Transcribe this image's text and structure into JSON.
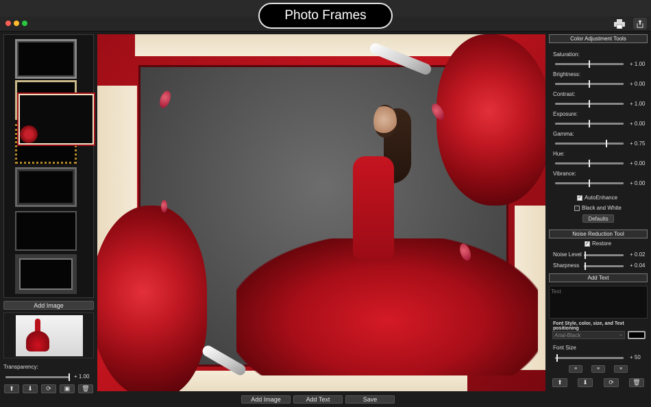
{
  "window": {
    "title": "Photo Frames"
  },
  "left": {
    "add_image_label": "Add Image",
    "transparency_label": "Transparency:",
    "transparency_value": "+ 1.00",
    "transparency_level": 1.0
  },
  "bottom": {
    "add_image_label": "Add Image",
    "add_text_label": "Add Text",
    "save_label": "Save"
  },
  "color_tools": {
    "title": "Color Adjustment Tools",
    "sliders": [
      {
        "label": "Saturation:",
        "value": "+ 1.00",
        "level": 0.5
      },
      {
        "label": "Brightness:",
        "value": "+ 0.00",
        "level": 0.5
      },
      {
        "label": "Contrast:",
        "value": "+ 1.00",
        "level": 0.5
      },
      {
        "label": "Exposure:",
        "value": "+ 0.00",
        "level": 0.5
      },
      {
        "label": "Gamma:",
        "value": "+ 0.75",
        "level": 0.75
      },
      {
        "label": "Hue:",
        "value": "+ 0.00",
        "level": 0.5
      },
      {
        "label": "Vibrance:",
        "value": "+ 0.00",
        "level": 0.5
      }
    ],
    "auto_enhance_label": "AutoEnhance",
    "auto_enhance_checked": true,
    "bw_label": "Black and White",
    "bw_checked": false,
    "defaults_label": "Defaults"
  },
  "noise_tool": {
    "title": "Noise Reduction Tool",
    "restore_label": "Restore",
    "restore_checked": true,
    "sliders": [
      {
        "label": "Noise Level",
        "value": "+ 0.02",
        "level": 0.02
      },
      {
        "label": "Sharpness",
        "value": "+ 0.04",
        "level": 0.02
      }
    ]
  },
  "add_text": {
    "title": "Add Text",
    "text_placeholder": "Text",
    "style_label": "Font Style, color, size, and Text positioning",
    "font_value": "Arial-Black",
    "font_size_label": "Font Size",
    "font_size_value": "+ 50",
    "font_size_level": 0.02
  },
  "icons": {
    "print": "printer-icon",
    "share": "share-icon",
    "up": "arrow-up-icon",
    "down": "arrow-down-icon",
    "rotate": "rotate-icon",
    "fit": "fit-icon",
    "trash": "trash-icon"
  },
  "colors": {
    "accent": "#c01822",
    "frame_paper": "#f3e9d5"
  }
}
